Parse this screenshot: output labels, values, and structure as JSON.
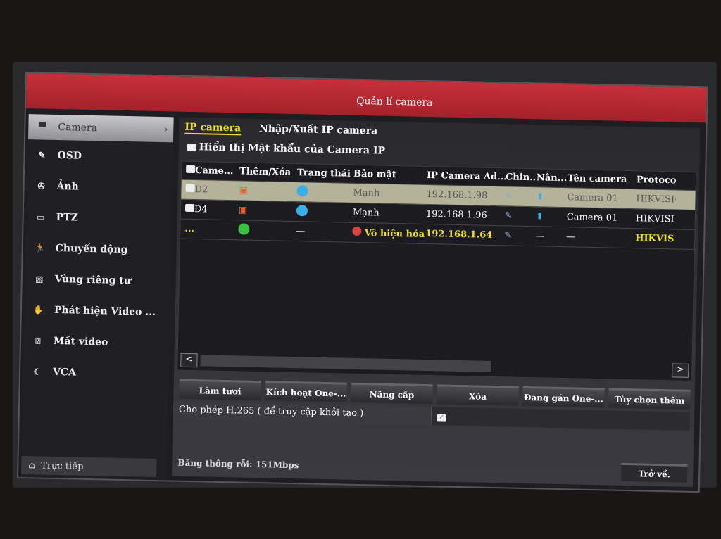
{
  "window": {
    "title": "Quản lí camera"
  },
  "sidebar": {
    "items": [
      {
        "label": "Camera",
        "icon": "camera-icon",
        "active": true
      },
      {
        "label": "OSD",
        "icon": "osd-icon"
      },
      {
        "label": "Ảnh",
        "icon": "image-icon"
      },
      {
        "label": "PTZ",
        "icon": "ptz-icon"
      },
      {
        "label": "Chuyển động",
        "icon": "motion-icon"
      },
      {
        "label": "Vùng riêng tư",
        "icon": "privacy-icon"
      },
      {
        "label": "Phát hiện Video ...",
        "icon": "tamper-icon"
      },
      {
        "label": "Mất video",
        "icon": "video-loss-icon"
      },
      {
        "label": "VCA",
        "icon": "vca-icon"
      }
    ],
    "live": "Trực tiếp"
  },
  "tabs": [
    {
      "label": "IP camera",
      "active": true
    },
    {
      "label": "Nhập/Xuất IP camera"
    }
  ],
  "show_password": "Hiển thị Mật khẩu của Camera IP",
  "table": {
    "headers": [
      "Came...",
      "Thêm/Xóa",
      "Trạng thái",
      "Bảo mật",
      "IP Camera Ad...",
      "Chin...",
      "Nân...",
      "Tên camera",
      "Protocol"
    ],
    "rows": [
      {
        "camera": "D2",
        "add_delete": "delete",
        "status": "online",
        "security": "Mạnh",
        "ip": "192.168.1.98",
        "name": "Camera 01",
        "protocol": "HIKVISIO",
        "selected": true
      },
      {
        "camera": "D4",
        "add_delete": "delete",
        "status": "online",
        "security": "Mạnh",
        "ip": "192.168.1.96",
        "name": "Camera 01",
        "protocol": "HIKVISIO"
      },
      {
        "camera": "...",
        "add_delete": "add",
        "status": "—",
        "security": "Vô hiệu hóa",
        "ip": "192.168.1.64",
        "upgrade": "—",
        "name": "—",
        "protocol": "HIKVISIO"
      }
    ]
  },
  "buttons": [
    "Làm tươi",
    "Kích hoạt One-...",
    "Nâng cấp",
    "Xóa",
    "Đang gán One-...",
    "Tùy chọn thêm"
  ],
  "h265": {
    "label": "Cho phép H.265 ( để truy cập khởi tạo )",
    "checked": true
  },
  "bandwidth": "Băng thông rỗi: 151Mbps",
  "back": "Trở về.",
  "colors": {
    "title_bar": "#b4262e",
    "active_tab": "#f0e020",
    "status_online": "#3aaee8",
    "add": "#3cc040",
    "delete": "#f06030",
    "disabled": "#e04040"
  }
}
